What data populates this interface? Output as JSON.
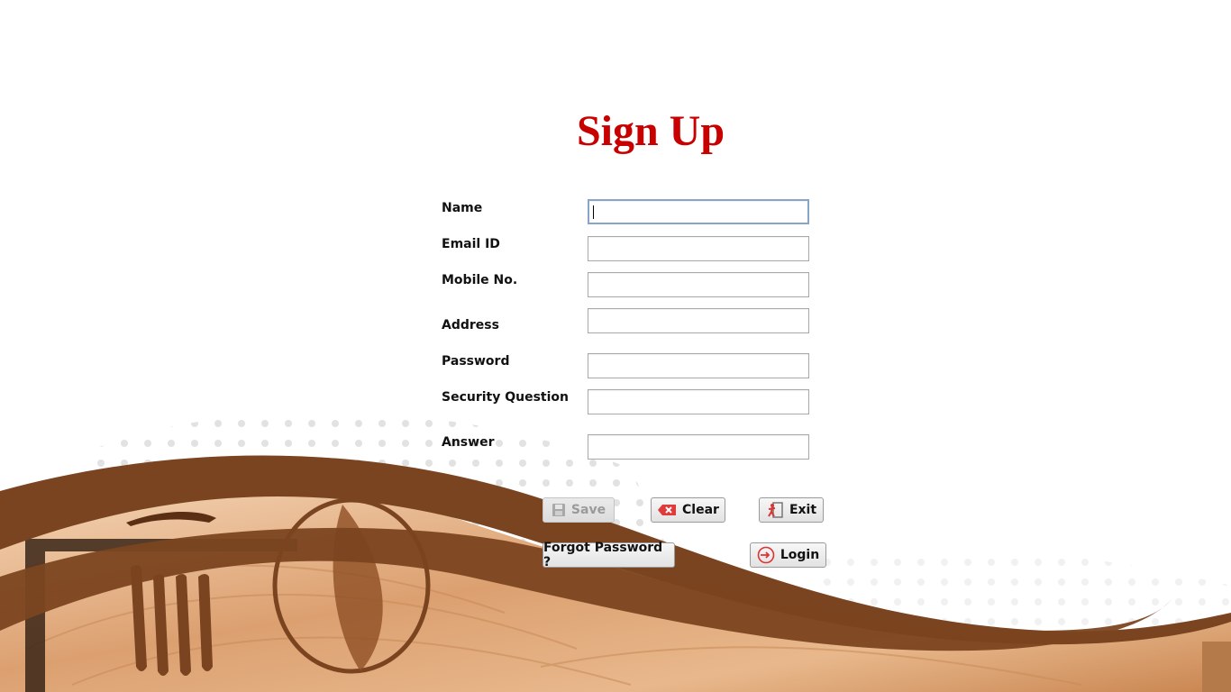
{
  "title": "Sign Up",
  "fields": [
    {
      "label": "Name",
      "value": "",
      "focused": true
    },
    {
      "label": "Email ID",
      "value": ""
    },
    {
      "label": "Mobile No.",
      "value": ""
    },
    {
      "label": "Address",
      "value": ""
    },
    {
      "label": "Password",
      "value": ""
    },
    {
      "label": "Security Question",
      "value": ""
    },
    {
      "label": "Answer",
      "value": ""
    }
  ],
  "buttons": {
    "save": {
      "label": "Save",
      "icon": "floppy-disk-icon",
      "enabled": false
    },
    "clear": {
      "label": "Clear",
      "icon": "clear-x-icon"
    },
    "exit": {
      "label": "Exit",
      "icon": "exit-door-icon"
    },
    "forgot": {
      "label": "Forgot Password ?"
    },
    "login": {
      "label": "Login",
      "icon": "login-arrow-icon"
    }
  },
  "colors": {
    "title": "#c80000",
    "swoosh": "#7b4420",
    "wood_light": "#f0c8a0",
    "wood_mid": "#d89a68"
  }
}
